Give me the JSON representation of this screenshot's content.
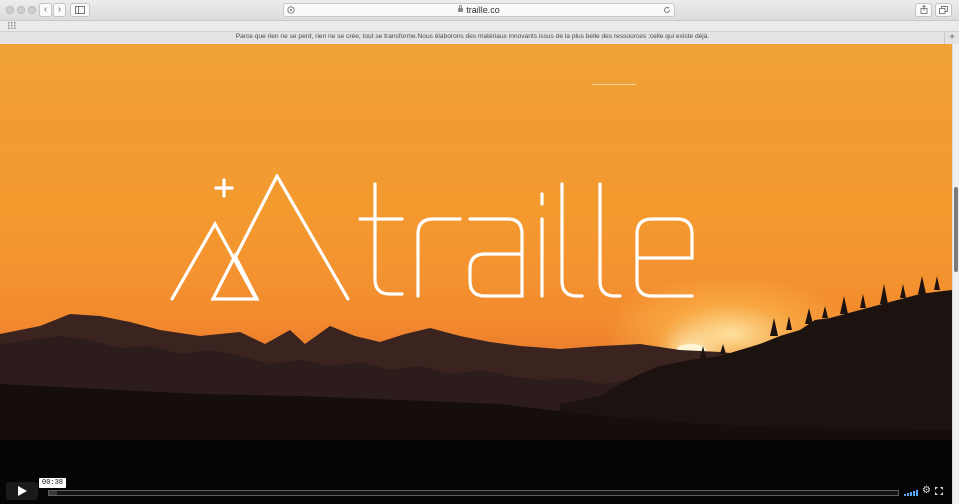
{
  "browser": {
    "url": "traille.co",
    "tab_title": "Parce que rien ne se perd, rien ne se crée, tout se transforme.Nous élaborons des matériaux innovants issus de la plus belle des ressources :celle qui existe déjà.",
    "icons": {
      "back": "chevron-left-icon",
      "forward": "chevron-right-icon",
      "sidebar": "sidebar-icon",
      "privacy": "shield-icon",
      "reload": "reload-icon",
      "share": "share-icon",
      "tabs": "tabs-overview-icon",
      "new_tab": "plus-icon",
      "favorites": "grid-icon"
    }
  },
  "hero": {
    "logo_text": "traille"
  },
  "player": {
    "current_time": "00:38",
    "progress_fraction": 0.01,
    "colors": {
      "volume": "#58a8ff"
    }
  }
}
